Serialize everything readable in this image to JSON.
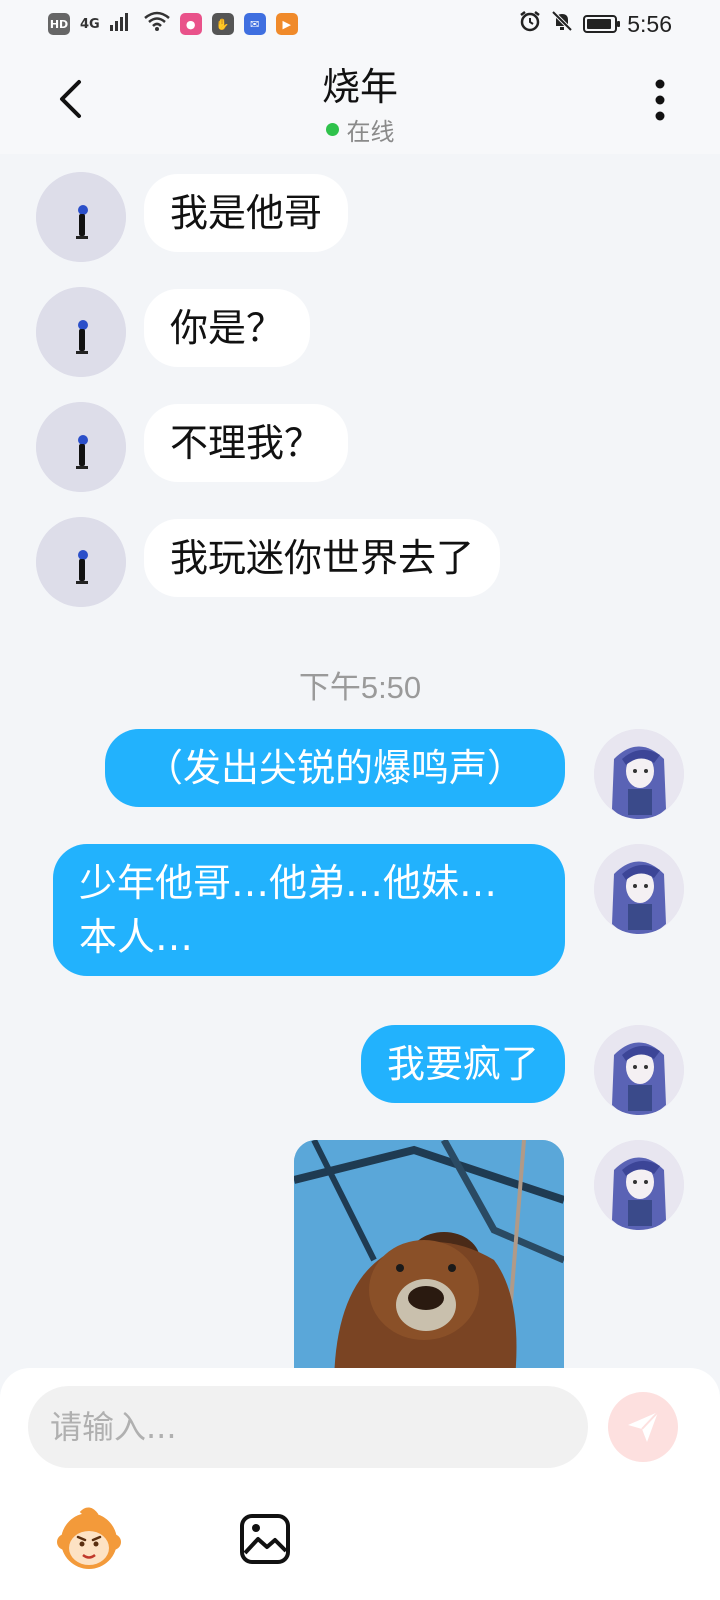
{
  "status_bar": {
    "network_badge": "HD",
    "signal_label": "4G",
    "time": "5:56"
  },
  "header": {
    "title": "烧年",
    "status": "在线"
  },
  "messages": {
    "incoming": [
      {
        "text": "我是他哥"
      },
      {
        "text": "你是？"
      },
      {
        "text": "不理我？"
      },
      {
        "text": "我玩迷你世界去了"
      }
    ],
    "timestamp": "下午5:50",
    "outgoing": [
      {
        "text": "（发出尖锐的爆鸣声）"
      },
      {
        "line1": "少年他哥…他弟…他妹…",
        "line2": "本人…"
      },
      {
        "text": "我要疯了"
      }
    ]
  },
  "input": {
    "placeholder": "请输入..."
  },
  "icons": {
    "back": "chevron-left-icon",
    "menu": "more-vertical-icon",
    "send": "paper-plane-icon",
    "sticker": "monkey-sticker-icon",
    "image": "image-icon"
  },
  "colors": {
    "outgoing_bubble": "#22b2fd",
    "incoming_bubble": "#ffffff",
    "online": "#2fc24b",
    "send_disabled": "#fde0df"
  }
}
